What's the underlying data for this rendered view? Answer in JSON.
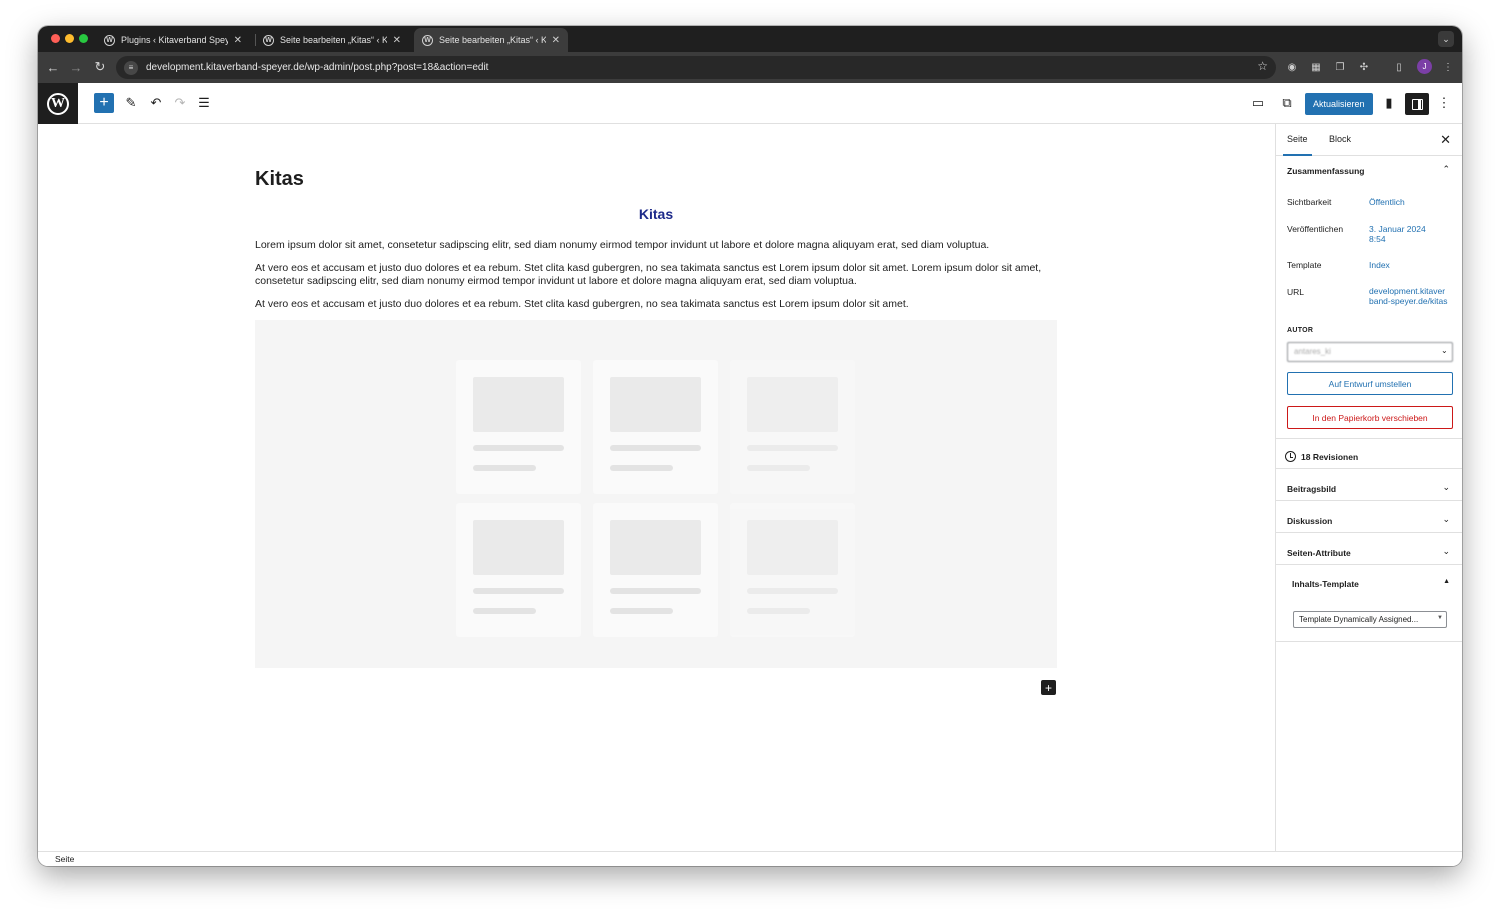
{
  "browser": {
    "tabs": [
      {
        "label": "Plugins ‹ Kitaverband Speyer"
      },
      {
        "label": "Seite bearbeiten „Kitas“ ‹ Kitaverband Speyer"
      },
      {
        "label": "Seite bearbeiten „Kitas“ ‹ Kitaverband Speyer"
      }
    ],
    "close_glyph": "✕",
    "url": "development.kitaverband-speyer.de/wp-admin/post.php?post=18&action=edit",
    "profile_initial": "J"
  },
  "toolbar": {
    "add_glyph": "+",
    "update_label": "Aktualisieren"
  },
  "editor": {
    "title": "Kitas",
    "heading": "Kitas",
    "paragraphs": [
      "Lorem ipsum dolor sit amet, consetetur sadipscing elitr, sed diam nonumy eirmod tempor invidunt ut labore et dolore magna aliquyam erat, sed diam voluptua.",
      "At vero eos et accusam et justo duo dolores et ea rebum. Stet clita kasd gubergren, no sea takimata sanctus est Lorem ipsum dolor sit amet. Lorem ipsum dolor sit amet, consetetur sadipscing elitr, sed diam nonumy eirmod tempor invidunt ut labore et dolore magna aliquyam erat, sed diam voluptua.",
      "At vero eos et accusam et justo duo dolores et ea rebum. Stet clita kasd gubergren, no sea takimata sanctus est Lorem ipsum dolor sit amet."
    ],
    "inserter_glyph": "+"
  },
  "sidebar": {
    "tabs": [
      "Seite",
      "Block"
    ],
    "close_glyph": "✕",
    "summary": {
      "title": "Zusammenfassung",
      "rows": [
        {
          "label": "Sichtbarkeit",
          "value": "Öffentlich"
        },
        {
          "label": "Veröffentlichen",
          "value": "3. Januar 2024 8:54"
        },
        {
          "label": "Template",
          "value": "Index"
        },
        {
          "label": "URL",
          "value": "development.kitaverband-speyer.de/kitas"
        }
      ],
      "author_label": "AUTOR",
      "author_value": "antares_ki",
      "draft_button": "Auf Entwurf umstellen",
      "trash_button": "In den Papierkorb verschieben"
    },
    "revisions": "18 Revisionen",
    "panels": [
      "Beitragsbild",
      "Diskussion",
      "Seiten-Attribute"
    ],
    "meta_box": {
      "title": "Inhalts-Template",
      "select_value": "Template Dynamically Assigned..."
    }
  },
  "footer": {
    "breadcrumb": "Seite"
  }
}
